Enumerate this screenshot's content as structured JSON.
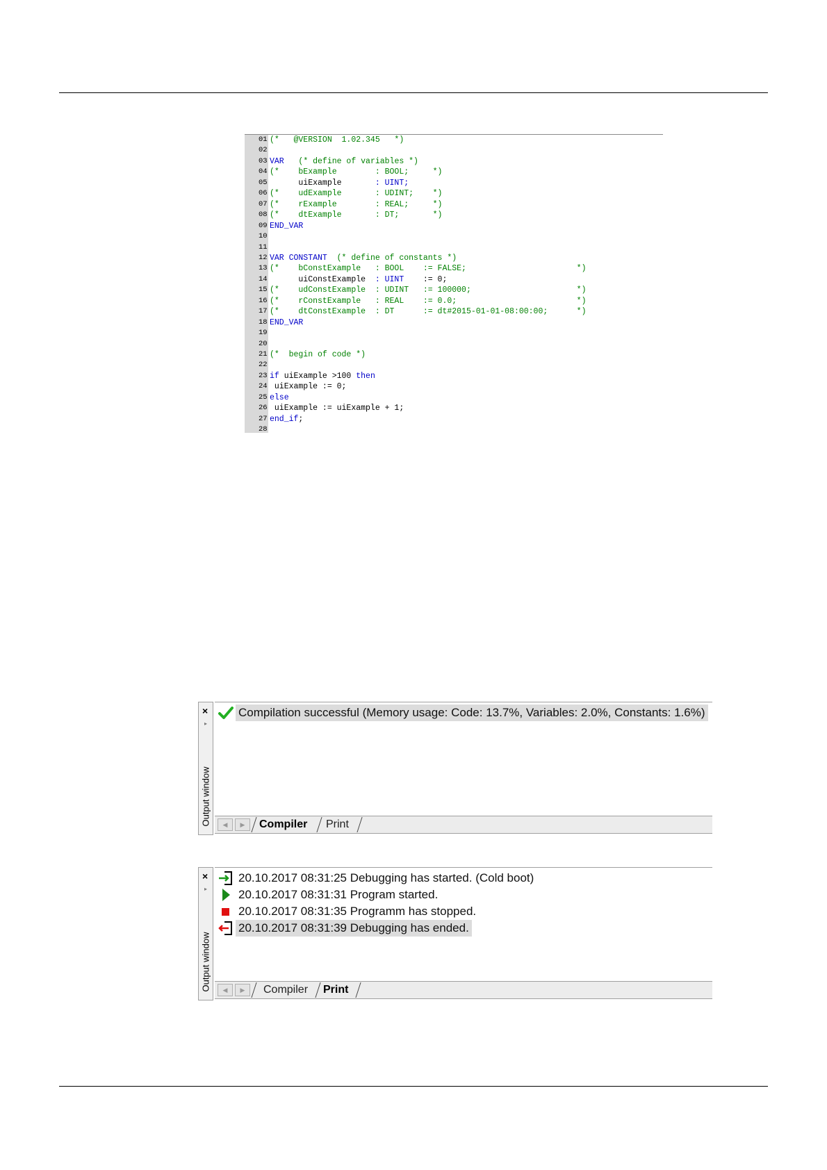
{
  "code_editor": {
    "lines": [
      {
        "n": "01",
        "parts": [
          {
            "t": "(*   @VERSION  1.02.345   *)",
            "c": "cm"
          }
        ]
      },
      {
        "n": "02",
        "parts": []
      },
      {
        "n": "03",
        "parts": [
          {
            "t": "VAR",
            "c": "kw"
          },
          {
            "t": "   (* define of variables *)",
            "c": "cm"
          }
        ]
      },
      {
        "n": "04",
        "parts": [
          {
            "t": "(*    bExample        : BOOL;     *)",
            "c": "cm"
          }
        ]
      },
      {
        "n": "05",
        "parts": [
          {
            "t": "      uiExample       ",
            "c": "tx"
          },
          {
            "t": ": UINT;",
            "c": "kw"
          }
        ]
      },
      {
        "n": "06",
        "parts": [
          {
            "t": "(*    udExample       : UDINT;    *)",
            "c": "cm"
          }
        ]
      },
      {
        "n": "07",
        "parts": [
          {
            "t": "(*    rExample        : REAL;     *)",
            "c": "cm"
          }
        ]
      },
      {
        "n": "08",
        "parts": [
          {
            "t": "(*    dtExample       : DT;       *)",
            "c": "cm"
          }
        ]
      },
      {
        "n": "09",
        "parts": [
          {
            "t": "END_VAR",
            "c": "kw"
          }
        ]
      },
      {
        "n": "10",
        "parts": []
      },
      {
        "n": "11",
        "parts": []
      },
      {
        "n": "12",
        "parts": [
          {
            "t": "VAR CONSTANT",
            "c": "kw"
          },
          {
            "t": "  (* define of constants *)",
            "c": "cm"
          }
        ]
      },
      {
        "n": "13",
        "parts": [
          {
            "t": "(*    bConstExample   : BOOL    := FALSE;                       *)",
            "c": "cm"
          }
        ]
      },
      {
        "n": "14",
        "parts": [
          {
            "t": "      uiConstExample  ",
            "c": "tx"
          },
          {
            "t": ": UINT",
            "c": "kw"
          },
          {
            "t": "    := 0;",
            "c": "tx"
          }
        ]
      },
      {
        "n": "15",
        "parts": [
          {
            "t": "(*    udConstExample  : UDINT   := 100000;                      *)",
            "c": "cm"
          }
        ]
      },
      {
        "n": "16",
        "parts": [
          {
            "t": "(*    rConstExample   : REAL    := 0.0;                         *)",
            "c": "cm"
          }
        ]
      },
      {
        "n": "17",
        "parts": [
          {
            "t": "(*    dtConstExample  : DT      := dt#2015-01-01-08:00:00;      *)",
            "c": "cm"
          }
        ]
      },
      {
        "n": "18",
        "parts": [
          {
            "t": "END_VAR",
            "c": "kw"
          }
        ]
      },
      {
        "n": "19",
        "parts": []
      },
      {
        "n": "20",
        "parts": []
      },
      {
        "n": "21",
        "parts": [
          {
            "t": "(*  begin of code *)",
            "c": "cm"
          }
        ]
      },
      {
        "n": "22",
        "parts": []
      },
      {
        "n": "23",
        "parts": [
          {
            "t": "if",
            "c": "kw"
          },
          {
            "t": " uiExample >100 ",
            "c": "tx"
          },
          {
            "t": "then",
            "c": "kw"
          }
        ]
      },
      {
        "n": "24",
        "parts": [
          {
            "t": " uiExample := 0;",
            "c": "tx"
          }
        ]
      },
      {
        "n": "25",
        "parts": [
          {
            "t": "else",
            "c": "kw"
          }
        ]
      },
      {
        "n": "26",
        "parts": [
          {
            "t": " uiExample := uiExample + 1;",
            "c": "tx"
          }
        ]
      },
      {
        "n": "27",
        "parts": [
          {
            "t": "end_if",
            "c": "kw"
          },
          {
            "t": ";",
            "c": "tx"
          }
        ]
      },
      {
        "n": "28",
        "parts": []
      }
    ]
  },
  "output_window_compiler": {
    "side_label": "Output window",
    "close_glyph": "×",
    "pin_glyph": "▸",
    "messages": [
      {
        "icon": "check-icon",
        "text": "Compilation successful (Memory usage: Code: 13.7%, Variables: 2.0%, Constants: 1.6%)",
        "selected": true
      }
    ],
    "tabs": [
      {
        "label": "Compiler",
        "active": true
      },
      {
        "label": "Print",
        "active": false
      }
    ],
    "nav_prev": "◀",
    "nav_next": "▶"
  },
  "output_window_print": {
    "side_label": "Output window",
    "close_glyph": "×",
    "pin_glyph": "▸",
    "messages": [
      {
        "icon": "debug-start-icon",
        "text": "20.10.2017 08:31:25 Debugging has started. (Cold boot)",
        "selected": false
      },
      {
        "icon": "play-icon",
        "text": "20.10.2017 08:31:31 Program started.",
        "selected": false
      },
      {
        "icon": "stop-icon",
        "text": "20.10.2017 08:31:35 Programm has stopped.",
        "selected": false
      },
      {
        "icon": "debug-end-icon",
        "text": "20.10.2017 08:31:39 Debugging has ended.",
        "selected": true
      }
    ],
    "tabs": [
      {
        "label": "Compiler",
        "active": false
      },
      {
        "label": "Print",
        "active": true
      }
    ],
    "nav_prev": "◀",
    "nav_next": "▶"
  },
  "colors": {
    "keyword": "#0000c8",
    "comment": "#008000",
    "check": "#22b022",
    "play": "#1a8a1a",
    "stop": "#e01010",
    "debug_start_arrow": "#1a9a1a",
    "debug_end_arrow": "#e01010"
  }
}
